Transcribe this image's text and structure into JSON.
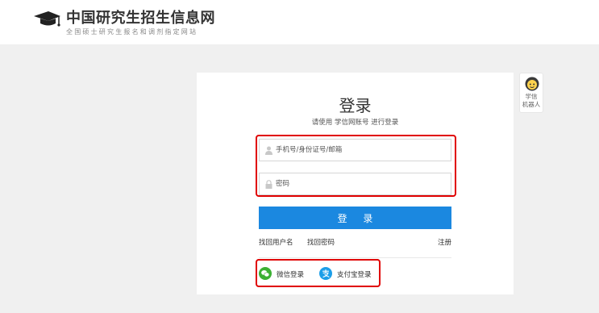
{
  "header": {
    "site_title": "中国研究生招生信息网",
    "site_subtitle": "全国硕士研究生报名和调剂指定网站"
  },
  "robot": {
    "label_line1": "学信",
    "label_line2": "机器人"
  },
  "login": {
    "title": "登录",
    "subtitle": "请使用 学信网账号 进行登录",
    "username_placeholder": "手机号/身份证号/邮箱",
    "username_value": "",
    "password_placeholder": "密码",
    "password_value": "",
    "login_button": "登 录",
    "find_username": "找回用户名",
    "find_password": "找回密码",
    "register": "注册",
    "wechat_login": "微信登录",
    "alipay_login": "支付宝登录"
  },
  "icons": {
    "logo": "graduation-cap-icon",
    "robot": "robot-avatar-icon",
    "username": "user-icon",
    "password": "lock-icon",
    "wechat": "wechat-icon",
    "alipay": "alipay-icon"
  },
  "colors": {
    "primary": "#1b88e0",
    "highlight": "#e00000",
    "wechat": "#3cb034",
    "alipay": "#1c9ee8",
    "background": "#f0f0f0"
  }
}
